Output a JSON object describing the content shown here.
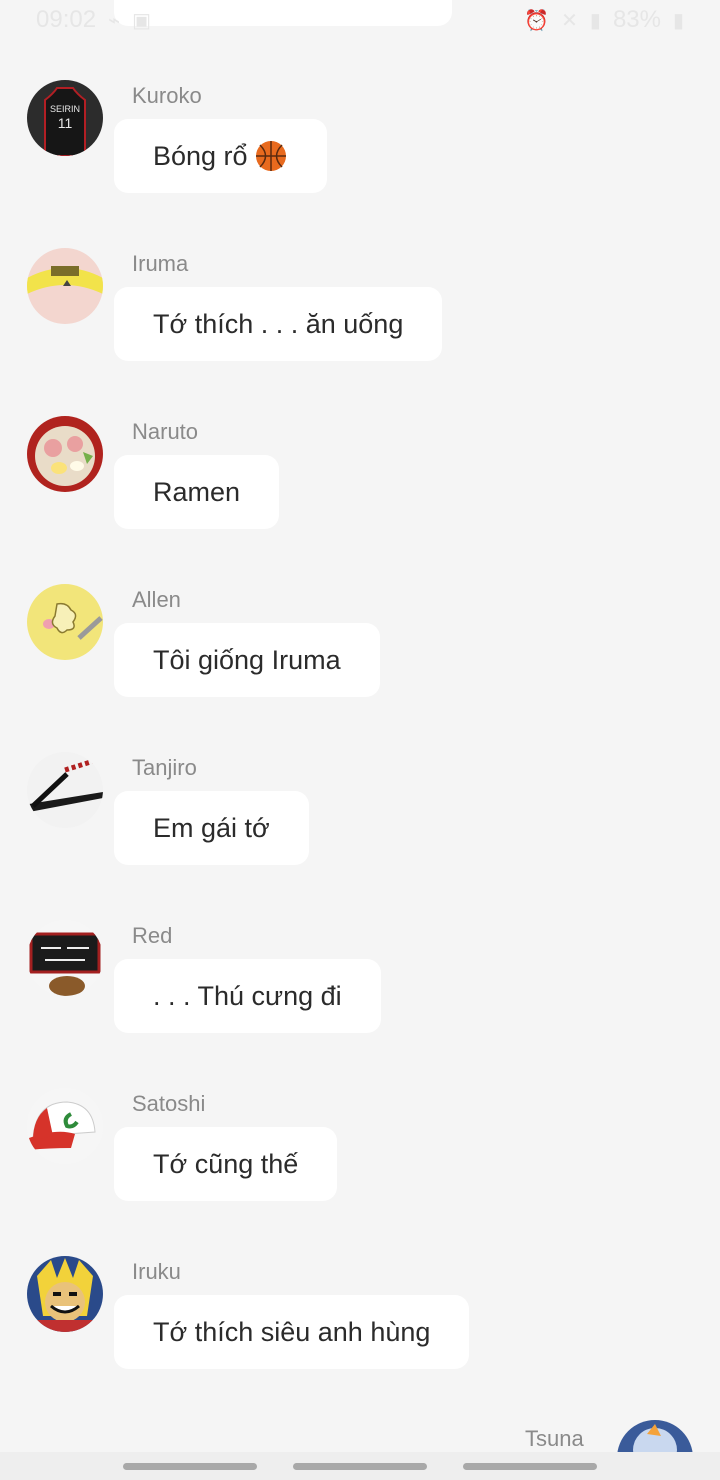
{
  "status_bar": {
    "time": "09:02",
    "battery": "83%"
  },
  "messages": [
    {
      "sender": "Kuroko",
      "text": "Bóng rổ",
      "emoji": "basketball-icon",
      "avatar": "jersey-avatar"
    },
    {
      "sender": "Iruma",
      "text": "Tớ thích . . . ăn uống",
      "avatar": "headband-avatar"
    },
    {
      "sender": "Naruto",
      "text": "Ramen",
      "avatar": "ramen-avatar"
    },
    {
      "sender": "Allen",
      "text": "Tôi giống Iruma",
      "avatar": "yellow-character-avatar"
    },
    {
      "sender": "Tanjiro",
      "text": "Em gái tớ",
      "avatar": "katana-avatar"
    },
    {
      "sender": "Red",
      "text": ". . . Thú cưng đi",
      "avatar": "sign-avatar"
    },
    {
      "sender": "Satoshi",
      "text": "Tớ cũng thế",
      "avatar": "cap-avatar"
    },
    {
      "sender": "Iruku",
      "text": "Tớ thích siêu anh hùng",
      "avatar": "hero-avatar"
    }
  ],
  "outgoing": {
    "sender": "Tsuna",
    "avatar": "tsuna-avatar"
  },
  "colors": {
    "background": "#f5f5f5",
    "bubble": "#ffffff",
    "sender_text": "#8a8a8a",
    "message_text": "#2b2b2b"
  }
}
